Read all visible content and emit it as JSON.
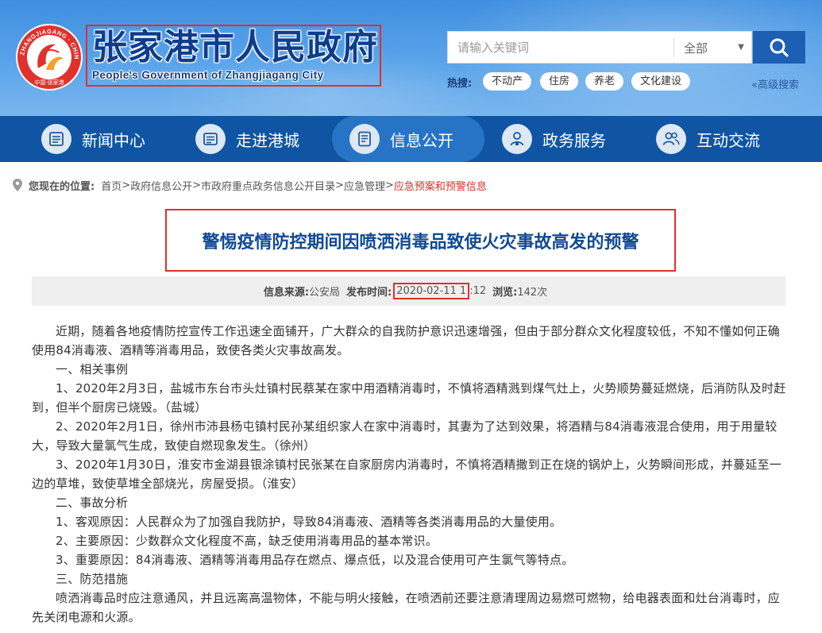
{
  "header": {
    "emblem_text_top": "ZHANGJIAGANG · CHINA",
    "emblem_text_bottom": "中国·张家港",
    "site_title_cn": "张家港市人民政府",
    "site_title_en": "People's Government of Zhangjiagang City"
  },
  "search": {
    "placeholder": "请输入关键词",
    "scope_value": "全部",
    "hot_label": "热搜:",
    "hot_tags": [
      "不动产",
      "住房",
      "养老",
      "文化建设"
    ],
    "advanced_label": "«高级搜索"
  },
  "nav": {
    "items": [
      {
        "label": "新闻中心",
        "icon": "newspaper-icon"
      },
      {
        "label": "走进港城",
        "icon": "city-list-icon"
      },
      {
        "label": "信息公开",
        "icon": "document-icon"
      },
      {
        "label": "政务服务",
        "icon": "person-service-icon"
      },
      {
        "label": "互动交流",
        "icon": "users-icon"
      }
    ],
    "active_index": 2
  },
  "breadcrumb": {
    "here_label": "您现在的位置:",
    "items": [
      "首页",
      "政府信息公开",
      "市政府重点政务信息公开目录",
      "应急管理"
    ],
    "current": "应急预案和预警信息"
  },
  "article": {
    "title": "警惕疫情防控期间因喷洒消毒品致使火灾事故高发的预警",
    "meta": {
      "source_label": "信息来源:",
      "source": "公安局",
      "time_label": "发布时间:",
      "time_highlight": "2020-02-11 1",
      "time_rest": ":12",
      "views_label": "浏览:",
      "views": "142次"
    },
    "paragraphs": [
      "近期，随着各地疫情防控宣传工作迅速全面铺开，广大群众的自我防护意识迅速增强，但由于部分群众文化程度较低，不知不懂如何正确使用84消毒液、酒精等消毒用品，致使各类火灾事故高发。",
      "一、相关事例",
      "1、2020年2月3日，盐城市东台市头灶镇村民蔡某在家中用酒精消毒时，不慎将酒精溅到煤气灶上，火势顺势蔓延燃烧，后消防队及时赶到，但半个厨房已烧毁。（盐城）",
      "2、2020年2月1日，徐州市沛县杨屯镇村民孙某组织家人在家中消毒时，其妻为了达到效果，将酒精与84消毒液混合使用，用于用量较大，导致大量氯气生成，致使自燃现象发生。（徐州）",
      "3、2020年1月30日，淮安市金湖县银涂镇村民张某在自家厨房内消毒时，不慎将酒精撒到正在烧的锅炉上，火势瞬间形成，并蔓延至一边的草堆，致使草堆全部烧光，房屋受损。（淮安）",
      "二、事故分析",
      "1、客观原因：人民群众为了加强自我防护，导致84消毒液、酒精等各类消毒用品的大量使用。",
      "2、主要原因：少数群众文化程度不高，缺乏使用消毒用品的基本常识。",
      "3、重要原因：84消毒液、酒精等消毒用品存在燃点、爆点低，以及混合使用可产生氯气等特点。",
      "三、防范措施",
      "喷洒消毒品时应注意通风，并且远离高温物体，不能与明火接触，在喷洒前还要注意清理周边易燃可燃物，给电器表面和灶台消毒时，应先关闭电源和火源。"
    ]
  },
  "colors": {
    "brand_blue": "#0f55a4",
    "active_nav": "#2774c6",
    "title_blue": "#114a94",
    "highlight_red": "#e0302b",
    "crumb_current": "#d6302a"
  }
}
